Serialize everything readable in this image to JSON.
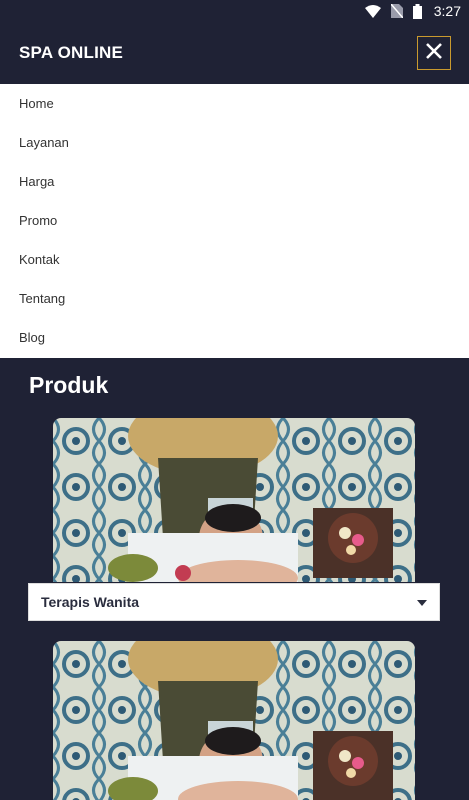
{
  "statusbar": {
    "time": "3:27",
    "icons": [
      "wifi-icon",
      "no-sim-icon",
      "battery-icon"
    ]
  },
  "header": {
    "brand": "SPA ONLINE",
    "close_icon": "close-icon",
    "accent_color": "#c99a2e"
  },
  "menu": {
    "items": [
      "Home",
      "Layanan",
      "Harga",
      "Promo",
      "Kontak",
      "Tentang",
      "Blog"
    ]
  },
  "main": {
    "section_title": "Produk",
    "products": [
      {
        "select_value": "Terapis Wanita"
      }
    ]
  },
  "colors": {
    "background": "#1f2235",
    "menu_bg": "#ffffff"
  }
}
